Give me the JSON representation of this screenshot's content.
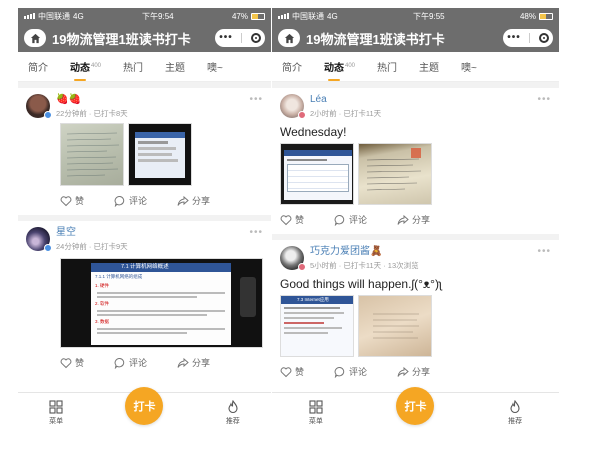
{
  "colors": {
    "accent": "#f5a623",
    "header": "#6d6d6d",
    "link": "#4a7fb5"
  },
  "screens": [
    {
      "status": {
        "carrier": "中国联通",
        "network": "4G",
        "time": "下午9:54",
        "battery": "47%",
        "battery_level": 0.47
      },
      "title": "19物流管理1班读书打卡",
      "tabs": [
        {
          "label": "简介"
        },
        {
          "label": "动态",
          "count": "400",
          "active": true
        },
        {
          "label": "热门"
        },
        {
          "label": "主题"
        },
        {
          "label": "噢~"
        }
      ],
      "posts": [
        {
          "name": "",
          "emoji": "🍓🍓",
          "meta": "22分钟前 · 已打卡8天",
          "text": ""
        },
        {
          "name": "星空",
          "meta": "24分钟前 · 已打卡9天",
          "text": ""
        }
      ],
      "actions": {
        "like": "赞",
        "comment": "评论",
        "share": "分享"
      },
      "slide_text": {
        "title": "7.1 计算机网络概述",
        "subtitle": "7.1.1 计算机网络的组成",
        "items": [
          "1. 硬件",
          "2. 软件",
          "3. 数据"
        ]
      },
      "nav": {
        "menu": "菜单",
        "checkin": "打卡",
        "recommend": "推荐"
      }
    },
    {
      "status": {
        "carrier": "中国联通",
        "network": "4G",
        "time": "下午9:55",
        "battery": "48%",
        "battery_level": 0.48
      },
      "title": "19物流管理1班读书打卡",
      "tabs": [
        {
          "label": "简介"
        },
        {
          "label": "动态",
          "count": "400",
          "active": true
        },
        {
          "label": "热门"
        },
        {
          "label": "主题"
        },
        {
          "label": "噢~"
        }
      ],
      "posts": [
        {
          "name": "Léa",
          "meta": "2小时前 · 已打卡11天",
          "text": "Wednesday!"
        },
        {
          "name": "巧克力爱团酱🧸",
          "meta": "5小时前 · 已打卡11天 · 13次浏览",
          "text": "Good things will happen.ʃ(°ᴥ°)ʅ"
        }
      ],
      "actions": {
        "like": "赞",
        "comment": "评论",
        "share": "分享"
      },
      "slide_text": {
        "title": "7.3 Internet应用"
      },
      "nav": {
        "menu": "菜单",
        "checkin": "打卡",
        "recommend": "推荐"
      }
    }
  ]
}
